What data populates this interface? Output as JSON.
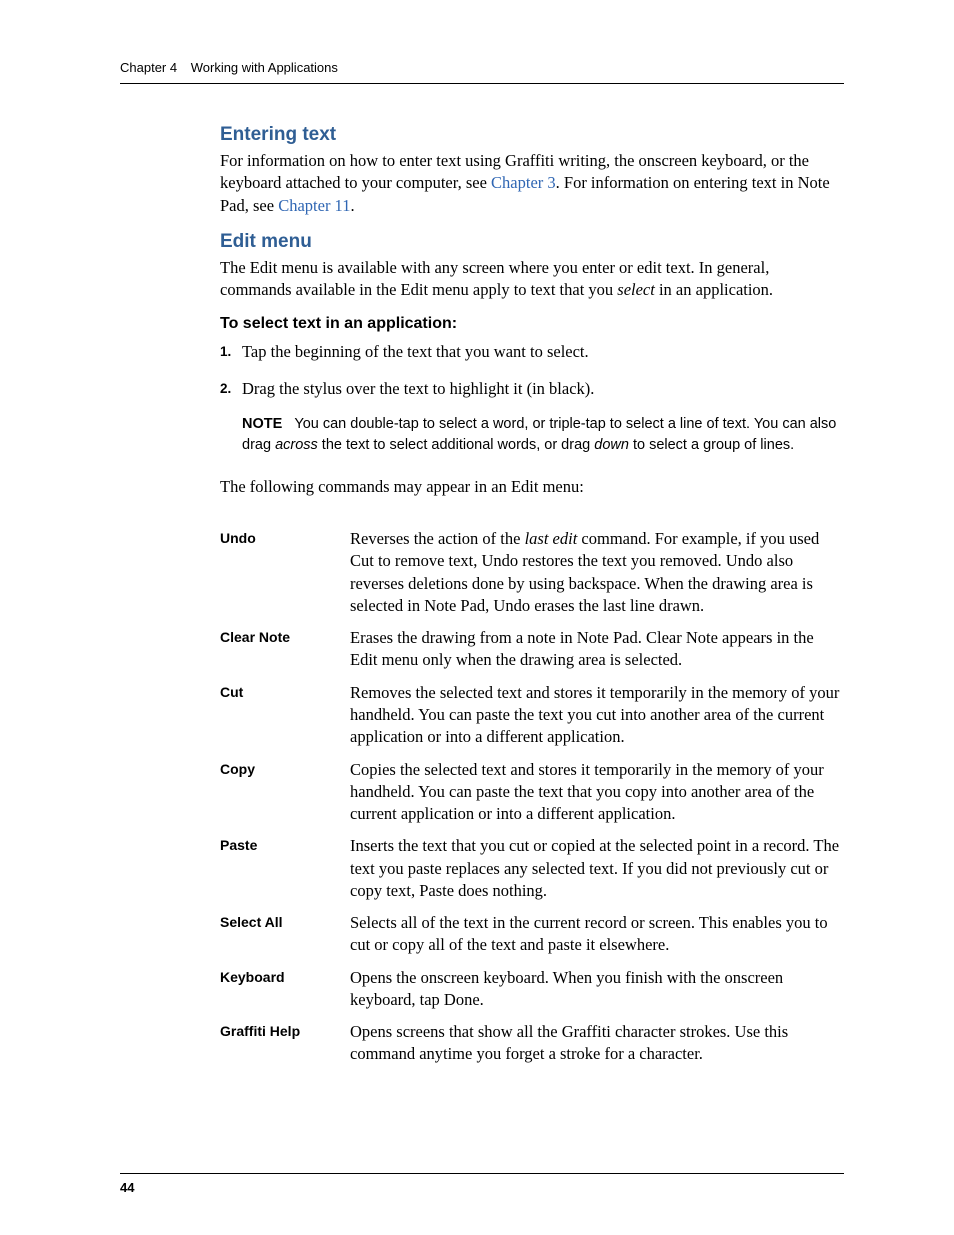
{
  "header": {
    "chapter": "Chapter 4",
    "title": "Working with Applications"
  },
  "sections": {
    "entering_text": {
      "heading": "Entering text",
      "para_a": "For information on how to enter text using Graffiti writing, the onscreen keyboard, or the keyboard attached to your computer, see ",
      "link1": "Chapter 3",
      "para_b": ". For information on entering text in Note Pad, see ",
      "link2": "Chapter 11",
      "para_c": "."
    },
    "edit_menu": {
      "heading": "Edit menu",
      "para_a": "The Edit menu is available with any screen where you enter or edit text. In general, commands available in the Edit menu apply to text that you ",
      "para_italic": "select",
      "para_b": " in an application.",
      "subhead": "To select text in an application:",
      "step1": "Tap the beginning of the text that you want to select.",
      "step2": "Drag the stylus over the text to highlight it (in black).",
      "note_label": "NOTE",
      "note_a": "You can double-tap to select a word, or triple-tap to select a line of text. You can also drag ",
      "note_italic1": "across",
      "note_b": " the text to select additional words, or drag ",
      "note_italic2": "down",
      "note_c": " to select a group of lines.",
      "after_note": "The following commands may appear in an Edit menu:"
    }
  },
  "commands": [
    {
      "term": "Undo",
      "desc_a": "Reverses the action of the ",
      "desc_italic": "last edit",
      "desc_b": " command. For example, if you used Cut to remove text, Undo restores the text you removed. Undo also reverses deletions done by using backspace. When the drawing area is selected in Note Pad, Undo erases the last line drawn."
    },
    {
      "term": "Clear Note",
      "desc_a": "Erases the drawing from a note in Note Pad. Clear Note appears in the Edit menu only when the drawing area is selected.",
      "desc_italic": "",
      "desc_b": ""
    },
    {
      "term": "Cut",
      "desc_a": "Removes the selected text and stores it temporarily in the memory of your handheld. You can paste the text you cut into another area of the current application or into a different application.",
      "desc_italic": "",
      "desc_b": ""
    },
    {
      "term": "Copy",
      "desc_a": "Copies the selected text and stores it temporarily in the memory of your handheld. You can paste the text that you copy into another area of the current application or into a different application.",
      "desc_italic": "",
      "desc_b": ""
    },
    {
      "term": "Paste",
      "desc_a": "Inserts the text that you cut or copied at the selected point in a record. The text you paste replaces any selected text. If you did not previously cut or copy text, Paste does nothing.",
      "desc_italic": "",
      "desc_b": ""
    },
    {
      "term": "Select All",
      "desc_a": "Selects all of the text in the current record or screen. This enables you to cut or copy all of the text and paste it elsewhere.",
      "desc_italic": "",
      "desc_b": ""
    },
    {
      "term": "Keyboard",
      "desc_a": "Opens the onscreen keyboard. When you finish with the onscreen keyboard, tap Done.",
      "desc_italic": "",
      "desc_b": ""
    },
    {
      "term": "Graffiti Help",
      "desc_a": "Opens screens that show all the Graffiti character strokes. Use this command anytime you forget a stroke for a character.",
      "desc_italic": "",
      "desc_b": ""
    }
  ],
  "page_number": "44"
}
